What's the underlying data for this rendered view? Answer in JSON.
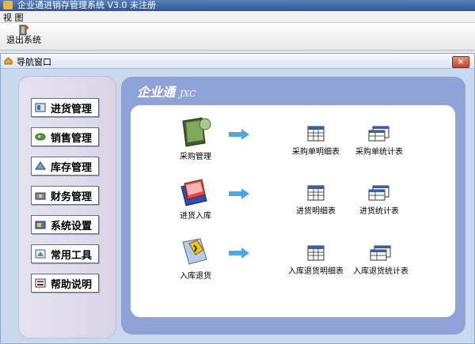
{
  "window": {
    "title": "企业通进销存管理系统 V3.0   未注册"
  },
  "menu": {
    "items": [
      "视 图"
    ]
  },
  "toolbar": {
    "exit_label": "退出系统"
  },
  "nav_window": {
    "title": "导航窗口",
    "close_label": "×"
  },
  "sidebar": {
    "items": [
      {
        "label": "进货管理",
        "icon": "purchase-icon"
      },
      {
        "label": "销售管理",
        "icon": "sales-icon"
      },
      {
        "label": "库存管理",
        "icon": "inventory-icon"
      },
      {
        "label": "财务管理",
        "icon": "finance-icon"
      },
      {
        "label": "系统设置",
        "icon": "settings-icon"
      },
      {
        "label": "常用工具",
        "icon": "tools-icon"
      },
      {
        "label": "帮助说明",
        "icon": "help-icon"
      }
    ]
  },
  "brand": {
    "name": "企业通",
    "sub": "JXC"
  },
  "rows": [
    {
      "main": "采购管理",
      "detail": "采购单明细表",
      "stats": "采购单统计表"
    },
    {
      "main": "进货入库",
      "detail": "进货明细表",
      "stats": "进货统计表"
    },
    {
      "main": "入库退货",
      "detail": "入库退货明细表",
      "stats": "入库退货统计表"
    }
  ],
  "colors": {
    "accent": "#8fa3d8",
    "arrow": "#4aa9e0",
    "titlebar": "#2f5596"
  }
}
